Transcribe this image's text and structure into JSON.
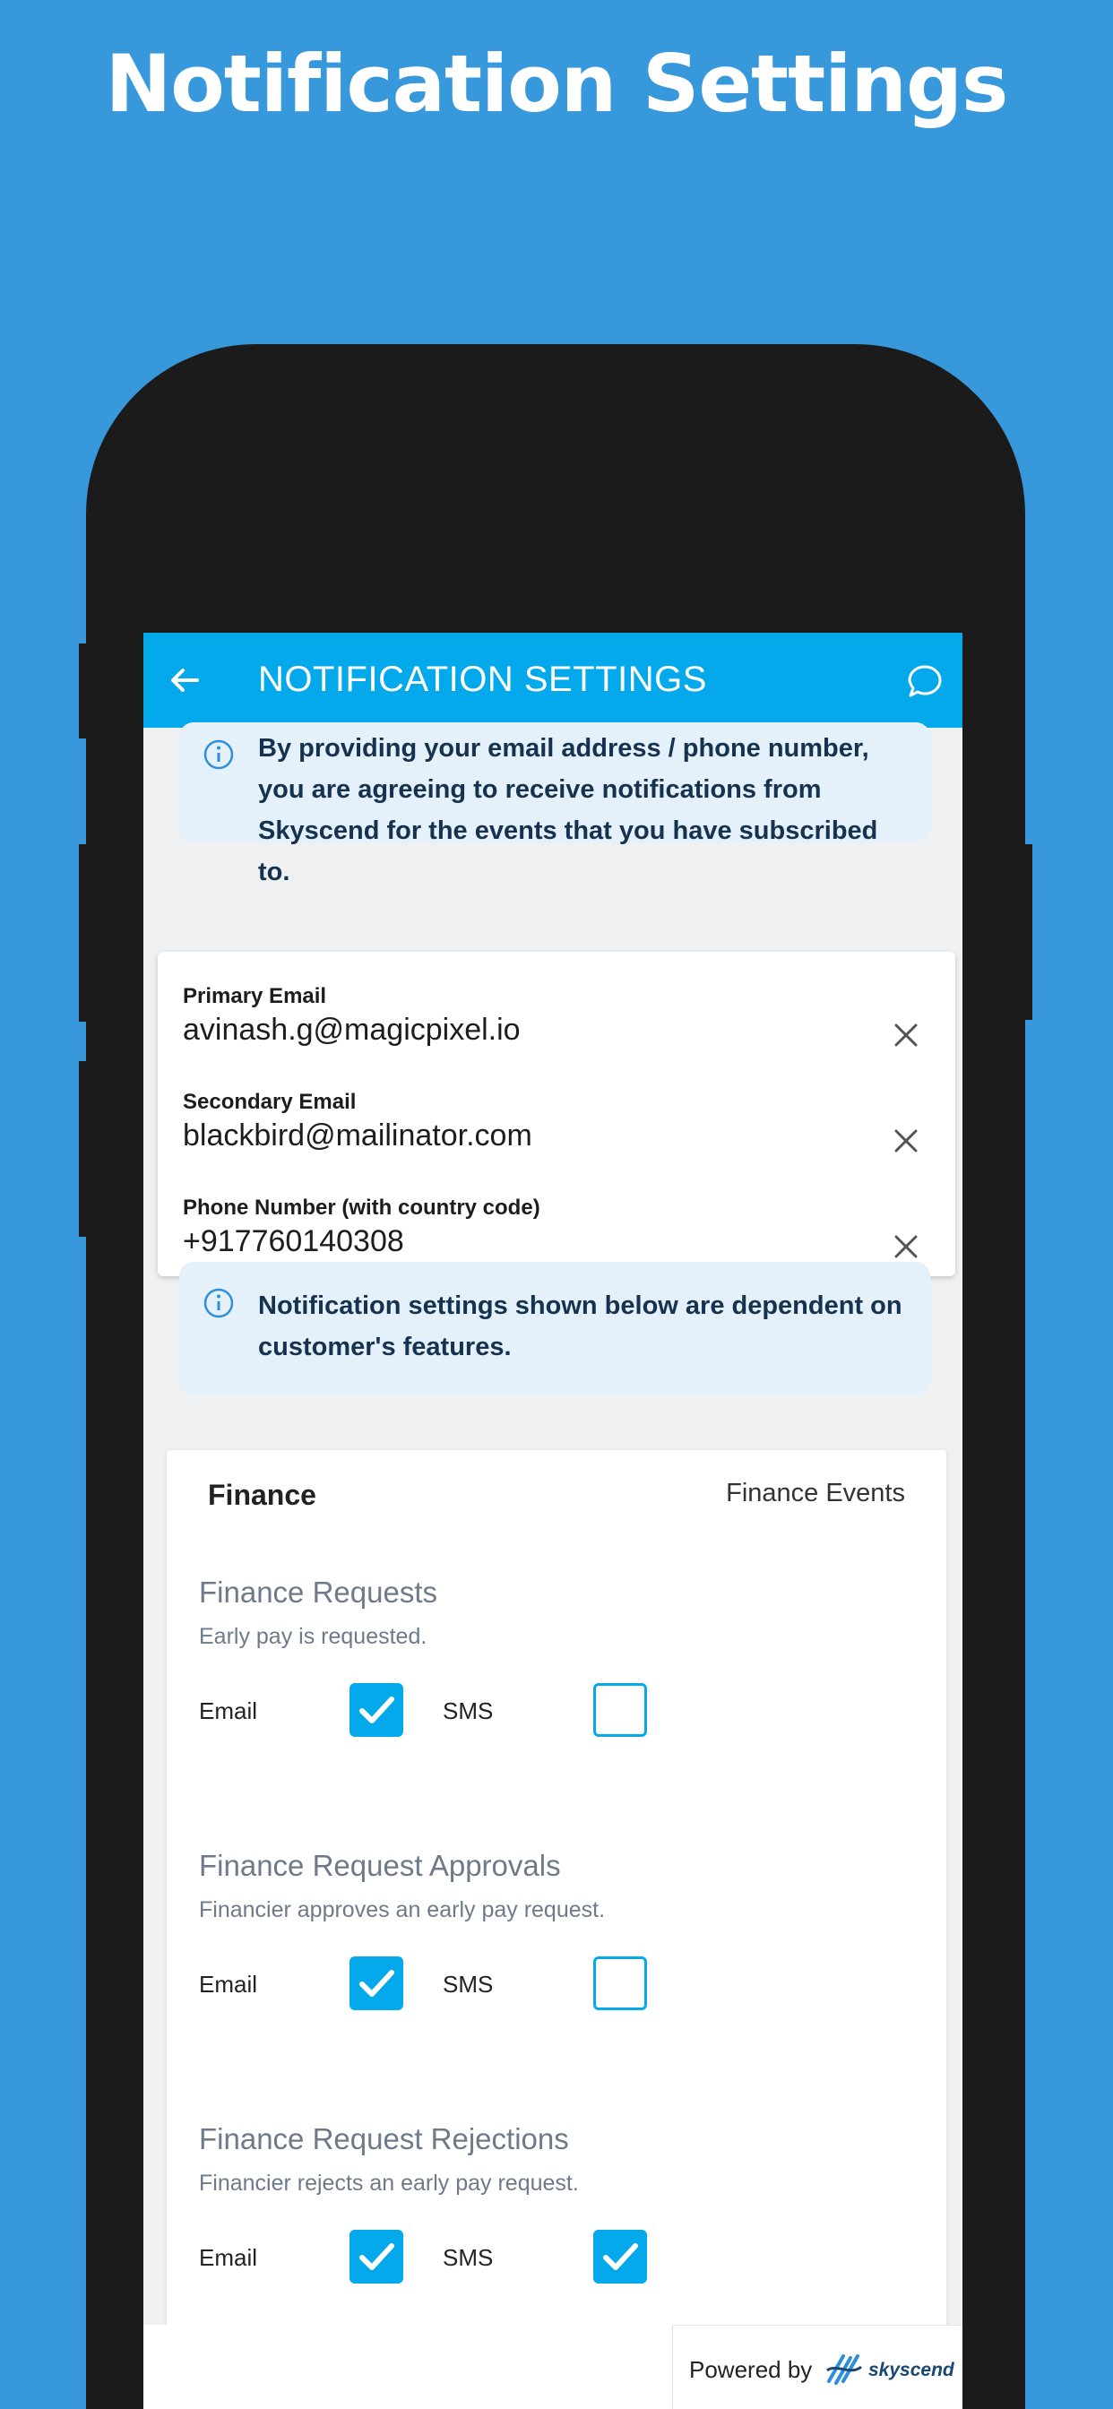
{
  "promo": {
    "title": "Notification Settings"
  },
  "appbar": {
    "title": "NOTIFICATION SETTINGS",
    "back_icon": "arrow-left-icon",
    "chat_icon": "chat-bubble-icon"
  },
  "info_banner_1": {
    "icon": "info-circle-icon",
    "text": "By providing your email address / phone number, you are agreeing to receive notifications from Skyscend for the events that you have subscribed to."
  },
  "contacts": {
    "primary_email": {
      "label": "Primary Email",
      "value": "avinash.g@magicpixel.io"
    },
    "secondary_email": {
      "label": "Secondary Email",
      "value": "blackbird@mailinator.com"
    },
    "phone": {
      "label": "Phone Number (with country code)",
      "value": "+917760140308"
    }
  },
  "info_banner_2": {
    "icon": "info-circle-icon",
    "text": "Notification settings shown below are dependent on customer's features."
  },
  "events": {
    "category": "Finance",
    "category_right": "Finance Events",
    "email_label": "Email",
    "sms_label": "SMS",
    "items": [
      {
        "name": "Finance Requests",
        "description": "Early pay is requested.",
        "email": true,
        "sms": false
      },
      {
        "name": "Finance Request Approvals",
        "description": "Financier approves an early pay request.",
        "email": true,
        "sms": false
      },
      {
        "name": "Finance Request Rejections",
        "description": "Financier rejects an early pay request.",
        "email": true,
        "sms": true
      }
    ]
  },
  "footer": {
    "powered_by": "Powered by",
    "brand": "skyscend"
  },
  "colors": {
    "background": "#3898dc",
    "accent": "#04a9ec",
    "info_bg": "#e4f1fb"
  }
}
